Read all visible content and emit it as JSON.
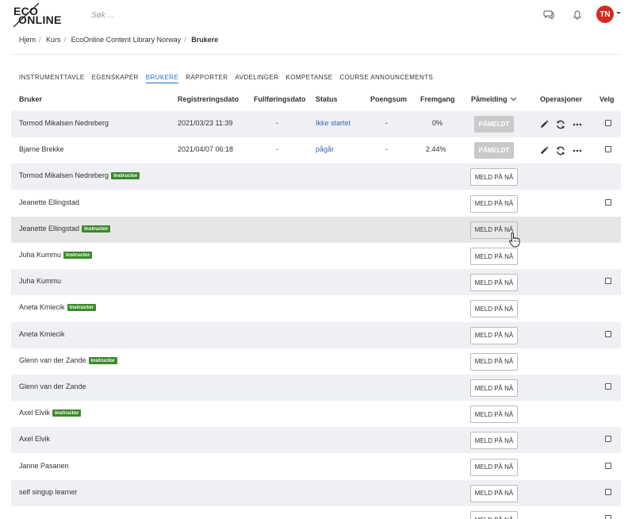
{
  "header": {
    "logo_line1": "ECO",
    "logo_line2": "ONLINE",
    "search_placeholder": "Søk ...",
    "avatar_initials": "TN",
    "icons": [
      "chat-icon",
      "bell-icon",
      "caret-down-icon"
    ],
    "colors": {
      "avatar": "#d52b1e"
    }
  },
  "breadcrumb": {
    "items": [
      "Hjem",
      "Kurs",
      "EcoOnline Content Library Norway"
    ],
    "current": "Brukere"
  },
  "tabs": [
    {
      "label": "INSTRUMENTTAVLE",
      "active": false
    },
    {
      "label": "EGENSKAPER",
      "active": false
    },
    {
      "label": "BRUKERE",
      "active": true
    },
    {
      "label": "RAPPORTER",
      "active": false
    },
    {
      "label": "AVDELINGER",
      "active": false
    },
    {
      "label": "KOMPETANSE",
      "active": false
    },
    {
      "label": "COURSE ANNOUNCEMENTS",
      "active": false
    }
  ],
  "table": {
    "columns": {
      "user": "Bruker",
      "registered": "Registreringsdato",
      "completed": "Fullføringsdato",
      "status": "Status",
      "score": "Poengsum",
      "progress": "Fremgang",
      "enrollment": "Påmelding",
      "operations": "Operasjoner",
      "select": "Velg"
    },
    "enrolled_label": "PÅMELDT",
    "enroll_label": "MELD PÅ NÅ",
    "instructor_badge": "Instructor",
    "rows": [
      {
        "name": "Tormod Mikalsen Nedreberg",
        "instructor": false,
        "registered": "2021/03/23 11:39",
        "completed": "-",
        "status": "Ikke startet",
        "score": "-",
        "progress": "0%",
        "enrolled": true,
        "checkbox": true
      },
      {
        "name": "Bjarne Brekke",
        "instructor": false,
        "registered": "2021/04/07 06:18",
        "completed": "-",
        "status": "pågår",
        "score": "-",
        "progress": "2.44%",
        "enrolled": true,
        "checkbox": true
      },
      {
        "name": "Tormod Mikalsen Nedreberg",
        "instructor": true,
        "enrolled": false,
        "checkbox": false
      },
      {
        "name": "Jeanette Ellingstad",
        "instructor": false,
        "enrolled": false,
        "checkbox": true
      },
      {
        "name": "Jeanette Ellingstad",
        "instructor": true,
        "enrolled": false,
        "checkbox": false,
        "hover": true
      },
      {
        "name": "Juha Kummu",
        "instructor": true,
        "enrolled": false,
        "checkbox": false
      },
      {
        "name": "Juha Kummu",
        "instructor": false,
        "enrolled": false,
        "checkbox": true
      },
      {
        "name": "Aneta Kmiecik",
        "instructor": true,
        "enrolled": false,
        "checkbox": false
      },
      {
        "name": "Aneta Kmiecik",
        "instructor": false,
        "enrolled": false,
        "checkbox": true
      },
      {
        "name": "Glenn van der Zande",
        "instructor": true,
        "enrolled": false,
        "checkbox": false
      },
      {
        "name": "Glenn van der Zande",
        "instructor": false,
        "enrolled": false,
        "checkbox": true
      },
      {
        "name": "Axel Elvik",
        "instructor": true,
        "enrolled": false,
        "checkbox": false
      },
      {
        "name": "Axel Elvik",
        "instructor": false,
        "enrolled": false,
        "checkbox": true
      },
      {
        "name": "Janne Pasanen",
        "instructor": false,
        "enrolled": false,
        "checkbox": true
      },
      {
        "name": "self singup learner",
        "instructor": false,
        "enrolled": false,
        "checkbox": true
      },
      {
        "name": "",
        "instructor": false,
        "enrolled": false,
        "checkbox": true
      }
    ]
  },
  "colors": {
    "accent": "#1a73c8",
    "status_link": "#3b63b8",
    "instructor_badge": "#3a8a2b",
    "row_shade": "#eef0f3"
  }
}
